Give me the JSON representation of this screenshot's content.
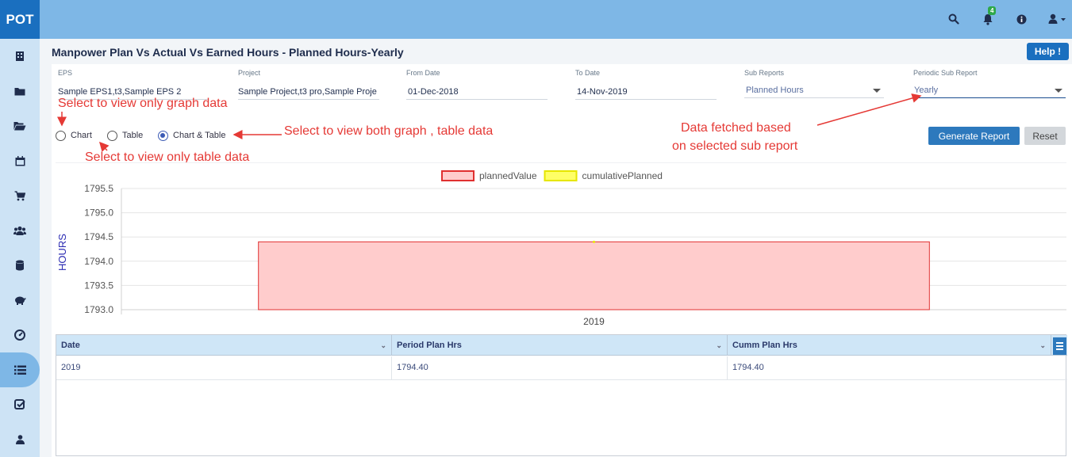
{
  "app": {
    "logo": "POT",
    "notification_count": "4"
  },
  "page": {
    "title": "Manpower Plan Vs Actual Vs Earned Hours - Planned Hours-Yearly",
    "help_label": "Help !"
  },
  "filters": {
    "eps": {
      "label": "EPS",
      "value": "Sample EPS1,t3,Sample EPS 2"
    },
    "project": {
      "label": "Project",
      "value": "Sample Project,t3 pro,Sample Proje"
    },
    "from_date": {
      "label": "From Date",
      "value": "01-Dec-2018"
    },
    "to_date": {
      "label": "To Date",
      "value": "14-Nov-2019"
    },
    "sub_reports": {
      "label": "Sub Reports",
      "value": "Planned Hours"
    },
    "periodic": {
      "label": "Periodic Sub Report",
      "value": "Yearly"
    }
  },
  "view_options": [
    {
      "label": "Chart",
      "checked": false
    },
    {
      "label": "Table",
      "checked": false
    },
    {
      "label": "Chart & Table",
      "checked": true
    }
  ],
  "buttons": {
    "generate": "Generate Report",
    "reset": "Reset"
  },
  "annotations": {
    "graph_only": "Select to view only graph data",
    "both": "Select to view both graph , table data",
    "table_only": "Select to view only table data",
    "sub_report_line1": "Data fetched based",
    "sub_report_line2": "on selected sub report"
  },
  "chart_data": {
    "type": "bar",
    "categories": [
      "2019"
    ],
    "series": [
      {
        "name": "plannedValue",
        "values": [
          1794.4
        ],
        "color": "#ffcccc",
        "stroke": "#e03030"
      },
      {
        "name": "cumulativePlanned",
        "values": [
          1794.4
        ],
        "color": "#ffff66",
        "stroke": "#e6e600"
      }
    ],
    "ylabel": "HOURS",
    "xlabel": "",
    "ylim": [
      1793.0,
      1795.5
    ],
    "yticks": [
      "1795.5",
      "1795.0",
      "1794.5",
      "1794.0",
      "1793.5",
      "1793.0"
    ],
    "legend": "top-center",
    "grid": true
  },
  "table": {
    "columns": [
      "Date",
      "Period Plan Hrs",
      "Cumm Plan Hrs"
    ],
    "rows": [
      [
        "2019",
        "1794.40",
        "1794.40"
      ]
    ]
  },
  "colors": {
    "topbar": "#7eb7e6",
    "brand": "#1a6fbf",
    "sidebar": "#cde3f5",
    "annotation": "#e53935"
  }
}
